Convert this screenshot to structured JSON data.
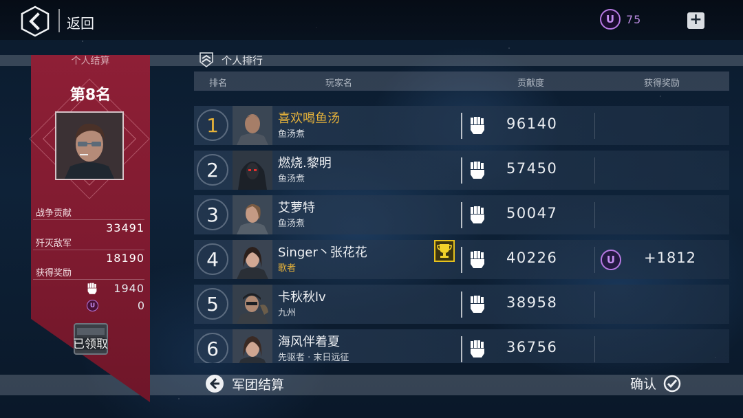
{
  "header": {
    "back_label": "返回",
    "currency_icon": "U",
    "currency_value": "75",
    "plus_label": "+"
  },
  "summary": {
    "title": "个人结算",
    "rank_title": "第8名",
    "stats": [
      {
        "label": "战争贡献",
        "value": "33491"
      },
      {
        "label": "歼灭敌军",
        "value": "18190"
      },
      {
        "label": "获得奖励",
        "value": ""
      }
    ],
    "rewards": [
      {
        "icon": "fist-icon",
        "value": "1940"
      },
      {
        "icon": "U",
        "value": "0"
      }
    ],
    "claimed_label": "已领取"
  },
  "ranking": {
    "title": "个人排行",
    "columns": [
      "排名",
      "玩家名",
      "贡献度",
      "获得奖励"
    ],
    "rows": [
      {
        "rank": "1",
        "name": "喜欢喝鱼汤",
        "guild": "鱼汤煮",
        "contribution": "96140",
        "reward": "",
        "highlight": true
      },
      {
        "rank": "2",
        "name": "燃烧.黎明",
        "guild": "鱼汤煮",
        "contribution": "57450",
        "reward": ""
      },
      {
        "rank": "3",
        "name": "艾萝特",
        "guild": "鱼汤煮",
        "contribution": "50047",
        "reward": ""
      },
      {
        "rank": "4",
        "name": "Singer丶张花花",
        "guild": "歌者",
        "contribution": "40226",
        "reward": "+1812",
        "reward_icon": "U",
        "trophy": true
      },
      {
        "rank": "5",
        "name": "卡秋秋lv",
        "guild": "九州",
        "contribution": "38958",
        "reward": ""
      },
      {
        "rank": "6",
        "name": "海风伴着夏",
        "guild": "先驱者 · 末日远征",
        "contribution": "36756",
        "reward": ""
      }
    ]
  },
  "footer": {
    "legion_label": "军团结算",
    "confirm_label": "确认"
  },
  "colors": {
    "panel_red": "#8e1f36",
    "gold": "#e6b23a",
    "currency_purple": "#b779e3"
  }
}
